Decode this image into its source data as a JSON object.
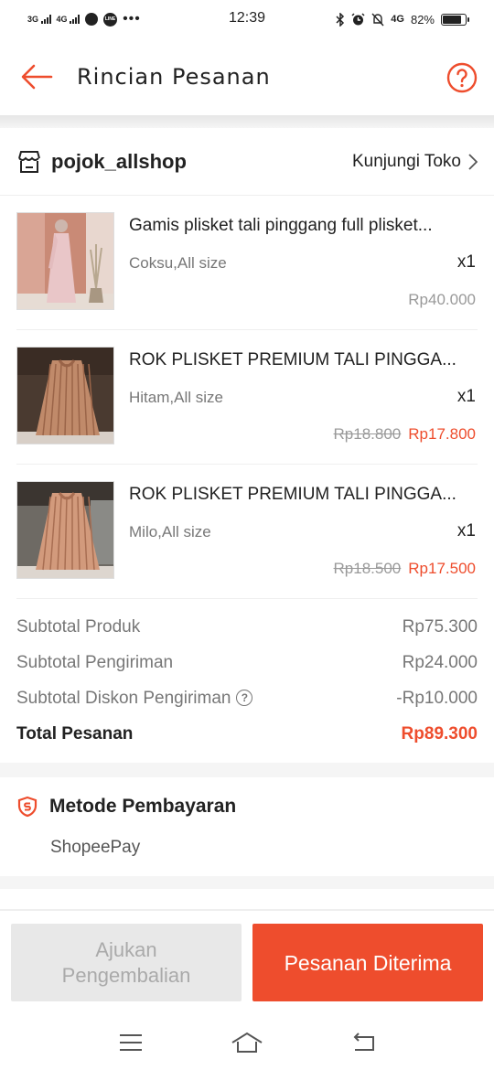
{
  "status_bar": {
    "network_1": "3G",
    "network_2": "4G",
    "time": "12:39",
    "network_right": "4G",
    "battery_text": "82%",
    "battery_level": 0.82
  },
  "header": {
    "title": "Rincian Pesanan"
  },
  "shop": {
    "name": "pojok_allshop",
    "visit_label": "Kunjungi Toko"
  },
  "items": [
    {
      "name": "Gamis plisket tali pinggang full plisket...",
      "variant": "Coksu,All size",
      "qty": "x1",
      "price_original": "Rp40.000",
      "price_discount": ""
    },
    {
      "name": "ROK PLISKET PREMIUM TALI PINGGA...",
      "variant": "Hitam,All size",
      "qty": "x1",
      "price_original": "Rp18.800",
      "price_discount": "Rp17.800"
    },
    {
      "name": "ROK PLISKET PREMIUM TALI PINGGA...",
      "variant": "Milo,All size",
      "qty": "x1",
      "price_original": "Rp18.500",
      "price_discount": "Rp17.500"
    }
  ],
  "summary": {
    "subtotal_product_label": "Subtotal Produk",
    "subtotal_product_value": "Rp75.300",
    "subtotal_shipping_label": "Subtotal Pengiriman",
    "subtotal_shipping_value": "Rp24.000",
    "shipping_discount_label": "Subtotal Diskon Pengiriman",
    "shipping_discount_value": "-Rp10.000",
    "total_label": "Total Pesanan",
    "total_value": "Rp89.300"
  },
  "payment": {
    "title": "Metode Pembayaran",
    "method": "ShopeePay"
  },
  "buttons": {
    "return_line1": "Ajukan",
    "return_line2": "Pengembalian",
    "received": "Pesanan Diterima"
  },
  "colors": {
    "accent": "#ee4d2d",
    "muted": "#777777",
    "disabled_bg": "#e8e8e8"
  }
}
